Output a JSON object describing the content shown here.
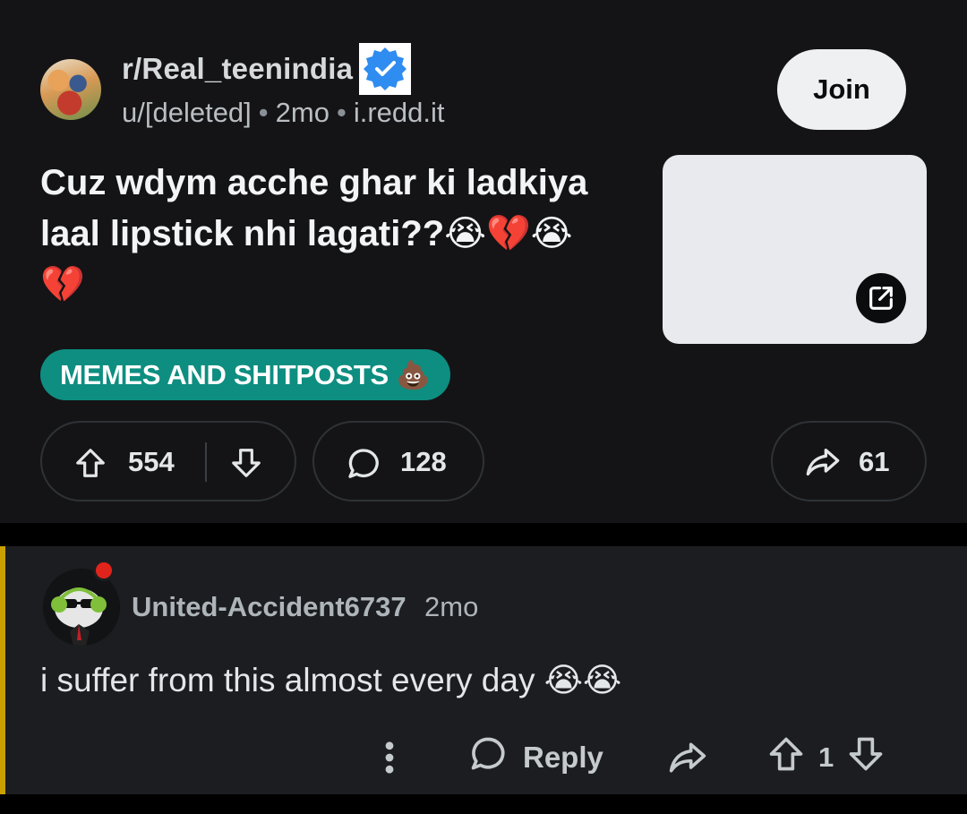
{
  "post": {
    "subreddit": "r/Real_teenindia",
    "author": "u/[deleted]",
    "age": "2mo",
    "domain": "i.redd.it",
    "join_label": "Join",
    "title": "Cuz wdym acche ghar ki ladkiya laal lipstick nhi lagati??😭💔😭💔",
    "flair": "MEMES AND SHITPOSTS 💩",
    "score": "554",
    "comments": "128",
    "shares": "61",
    "colors": {
      "flair_bg": "#0d8e80",
      "background": "#141416",
      "join_bg": "#eef0f2"
    }
  },
  "comment": {
    "author": "United-Accident6737",
    "age": "2mo",
    "body": "i suffer from this almost every day 😭😭",
    "reply_label": "Reply",
    "score": "1",
    "colors": {
      "thread_bar": "#c9a000",
      "background": "#1c1d20"
    }
  },
  "icons": [
    "verified-badge-icon",
    "external-link-icon",
    "upvote-icon",
    "downvote-icon",
    "comment-icon",
    "share-icon",
    "more-icon",
    "reply-icon"
  ]
}
